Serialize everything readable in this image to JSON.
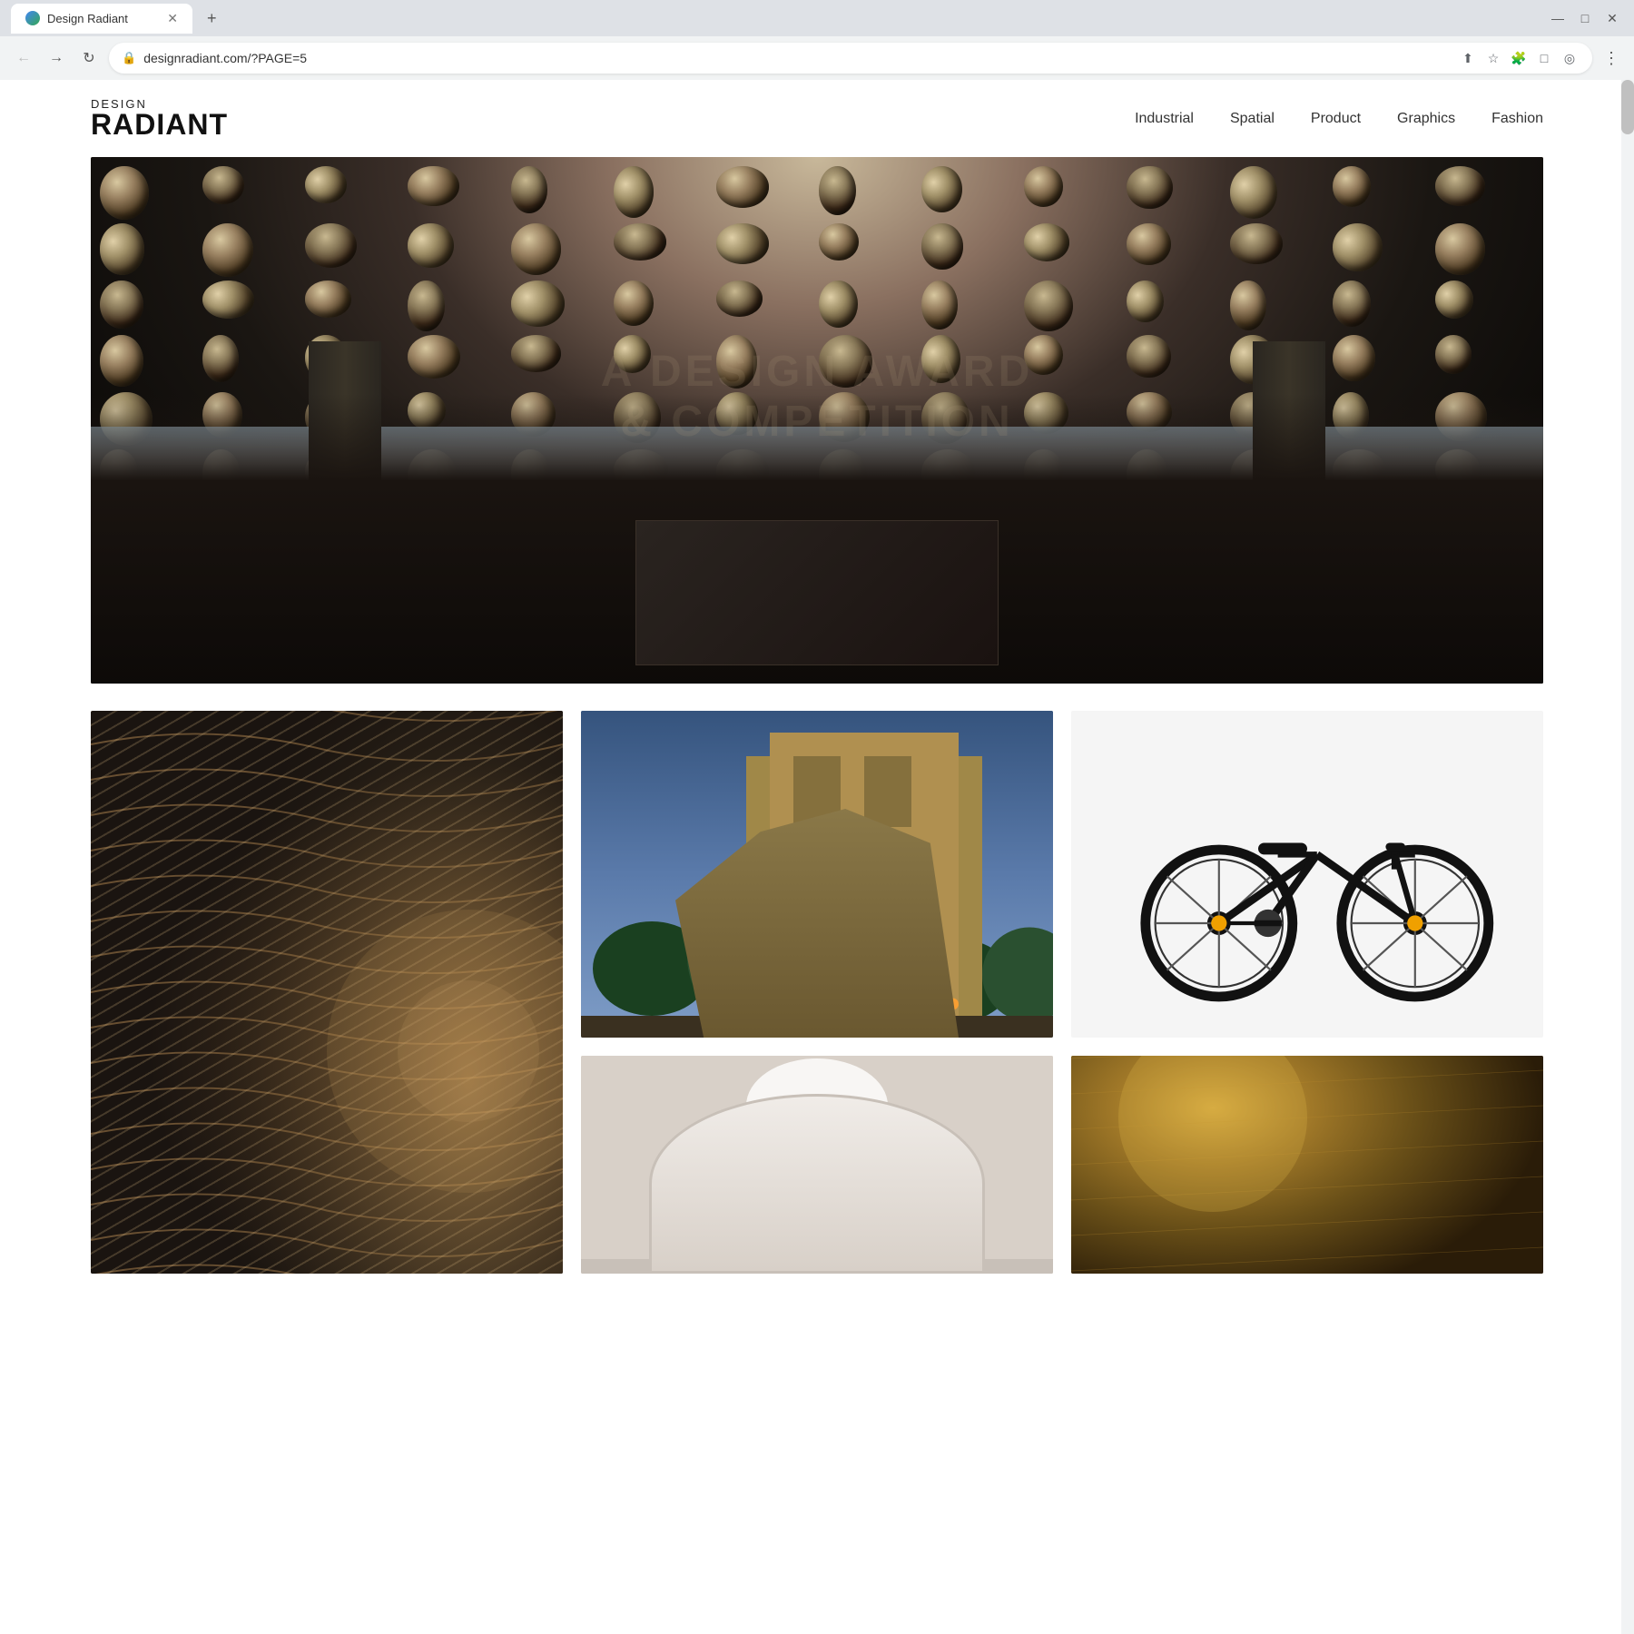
{
  "browser": {
    "tab_title": "Design Radiant",
    "tab_favicon": "globe",
    "url": "designradiant.com/?PAGE=5",
    "new_tab_label": "+",
    "nav": {
      "back_title": "Back",
      "forward_title": "Forward",
      "reload_title": "Reload"
    }
  },
  "site": {
    "logo_design": "DESIGN",
    "logo_radiant": "RADIANT",
    "nav_items": [
      {
        "label": "Industrial",
        "id": "industrial"
      },
      {
        "label": "Spatial",
        "id": "spatial"
      },
      {
        "label": "Product",
        "id": "product"
      },
      {
        "label": "Graphics",
        "id": "graphics"
      },
      {
        "label": "Fashion",
        "id": "fashion"
      }
    ]
  },
  "hero": {
    "watermark_line1": "A DESIGN AWARD",
    "watermark_line2": "& COMPETITION"
  },
  "grid": {
    "items": [
      {
        "id": "wavy-interior",
        "alt": "Wavy interior corridor",
        "type": "wavy"
      },
      {
        "id": "modern-building",
        "alt": "Modern building exterior at dusk",
        "type": "building"
      },
      {
        "id": "bicycle",
        "alt": "Black electric bicycle",
        "type": "bike"
      },
      {
        "id": "arch-interior",
        "alt": "Architectural arch interior",
        "type": "arch"
      },
      {
        "id": "gold-texture",
        "alt": "Gold texture surface",
        "type": "gold"
      }
    ]
  }
}
